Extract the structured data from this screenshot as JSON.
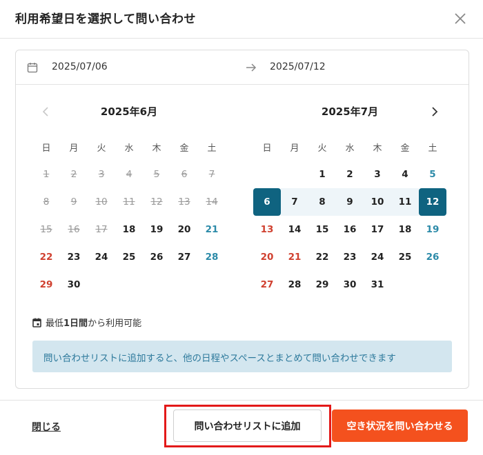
{
  "modal": {
    "title": "利用希望日を選択して問い合わせ"
  },
  "date_range": {
    "start": "2025/07/06",
    "end": "2025/07/12"
  },
  "calendar": {
    "weekdays": [
      "日",
      "月",
      "火",
      "水",
      "木",
      "金",
      "土"
    ],
    "months": [
      {
        "title": "2025年6月",
        "first_weekday": 0,
        "days": 30,
        "past_until": 17,
        "holidays": [],
        "selected": [],
        "in_range": []
      },
      {
        "title": "2025年7月",
        "first_weekday": 2,
        "days": 31,
        "past_until": 0,
        "holidays": [
          21
        ],
        "selected": [
          6,
          12
        ],
        "in_range": [
          7,
          8,
          9,
          10,
          11
        ]
      }
    ]
  },
  "note": {
    "prefix": "最低",
    "bold": "1日間",
    "suffix": "から利用可能"
  },
  "info_banner": "問い合わせリストに追加すると、他の日程やスペースとまとめて問い合わせできます",
  "footer": {
    "close_label": "閉じる",
    "add_list_label": "問い合わせリストに追加",
    "inquire_label": "空き状況を問い合わせる"
  },
  "colors": {
    "accent_primary": "#0f6380",
    "accent_range": "#eef5f9",
    "cta": "#f4511e",
    "sunday": "#d0402f",
    "saturday": "#2b8aa8",
    "highlight": "#e31919"
  },
  "icons": {
    "close": "close-icon",
    "calendar": "calendar-icon",
    "arrow": "arrow-right-icon",
    "prev": "chevron-left-icon",
    "next": "chevron-right-icon",
    "note": "calendar-small-icon"
  }
}
